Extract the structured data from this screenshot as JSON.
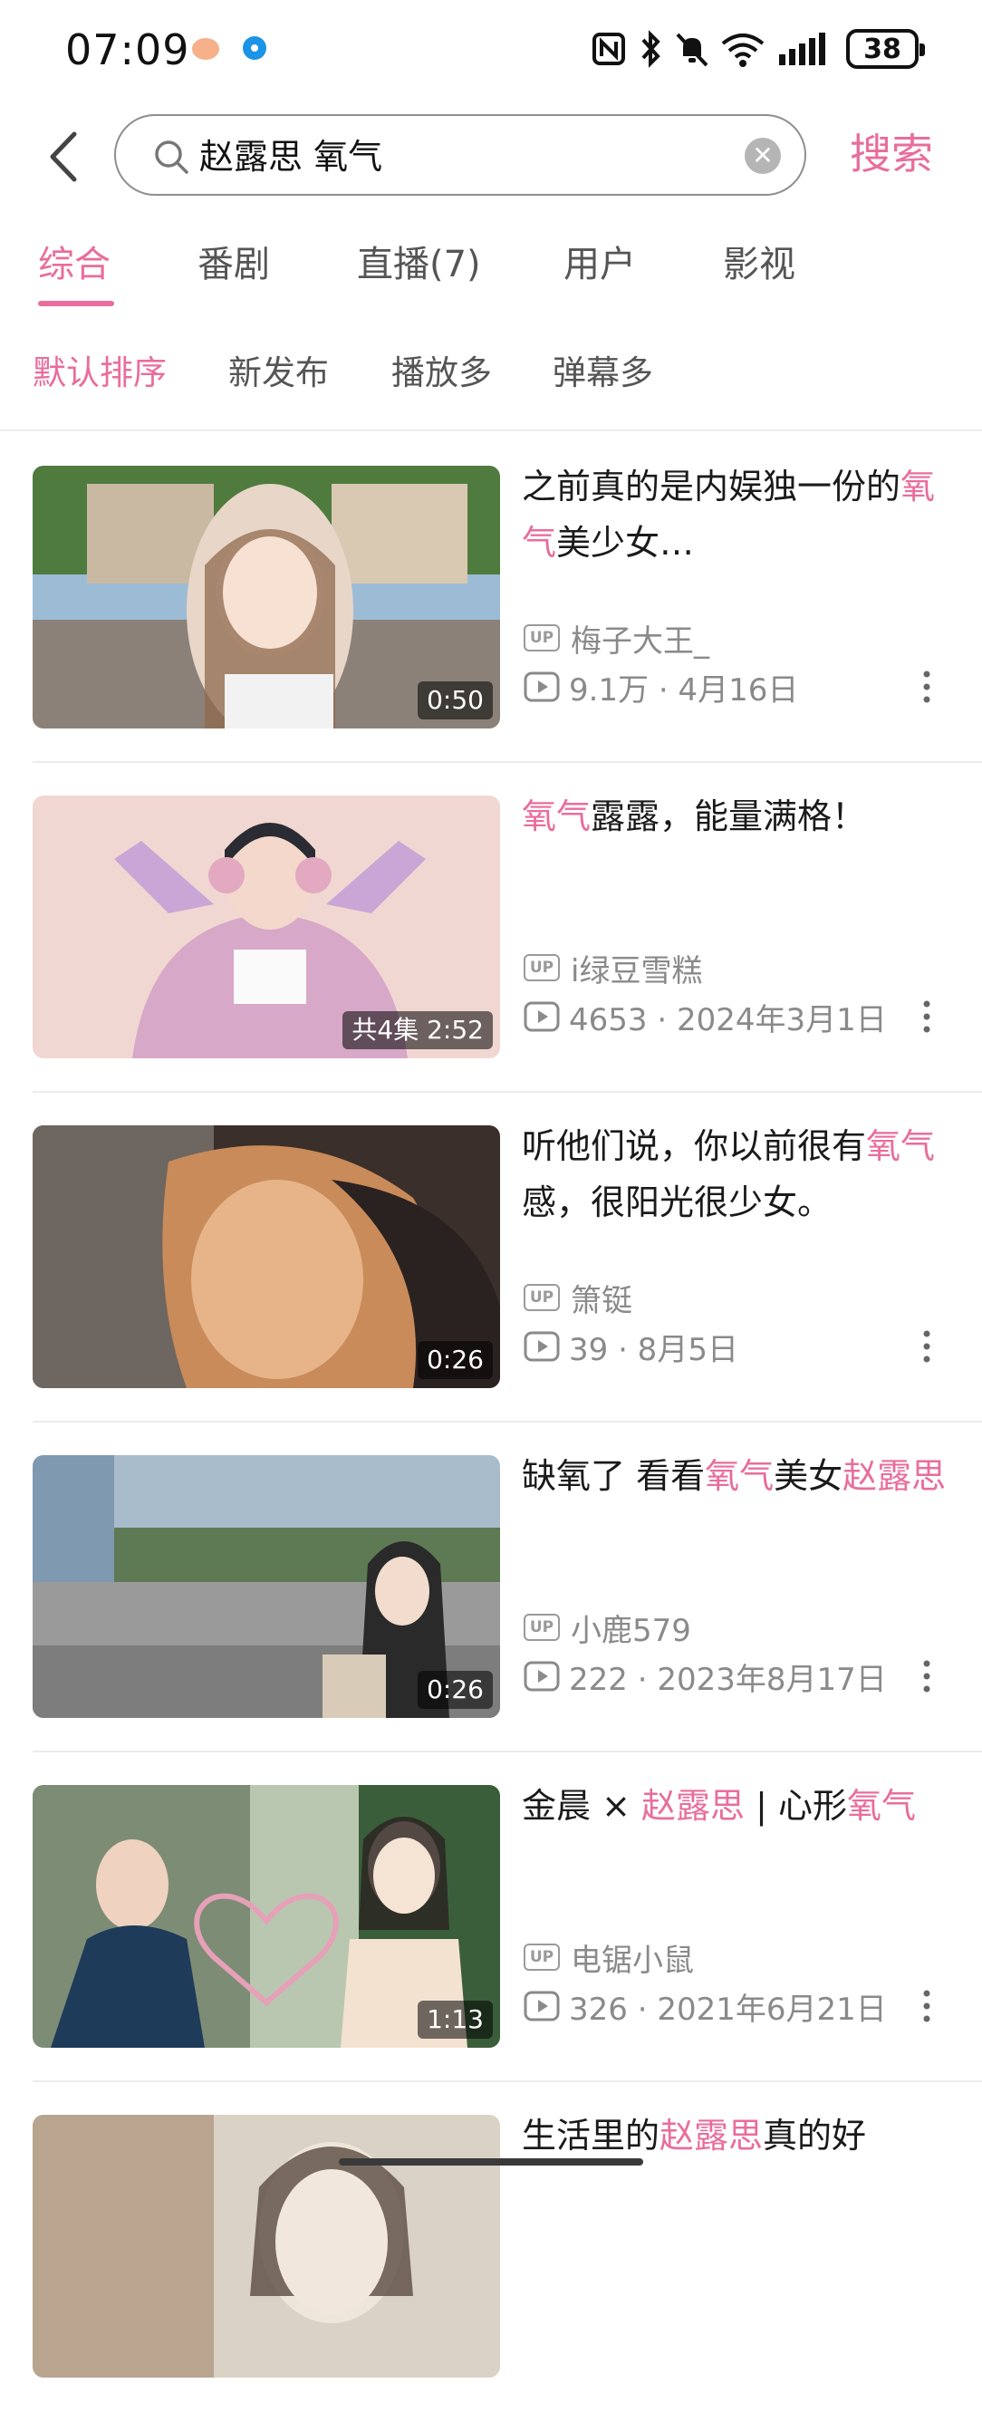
{
  "status_bar": {
    "time": "07:09",
    "battery": "38",
    "app_icons": [
      "weibo-icon",
      "app-notification-icon"
    ],
    "system_icons": [
      "nfc-icon",
      "bluetooth-icon",
      "mute-icon",
      "wifi-icon",
      "signal-icon"
    ]
  },
  "search": {
    "query": "赵露思 氧气",
    "search_button": "搜索"
  },
  "tabs": [
    {
      "label": "综合",
      "active": true
    },
    {
      "label": "番剧",
      "active": false
    },
    {
      "label": "直播(7)",
      "active": false
    },
    {
      "label": "用户",
      "active": false
    },
    {
      "label": "影视",
      "active": false
    }
  ],
  "sort_options": [
    {
      "label": "默认排序",
      "active": true
    },
    {
      "label": "新发布",
      "active": false
    },
    {
      "label": "播放多",
      "active": false
    },
    {
      "label": "弹幕多",
      "active": false
    }
  ],
  "up_badge": "UP",
  "results": [
    {
      "title": [
        {
          "t": "之前真的是内娱独一份的",
          "h": false
        },
        {
          "t": "氧气",
          "h": true
        },
        {
          "t": "美少女…",
          "h": false
        }
      ],
      "duration": "0:50",
      "uploader": "梅子大王_",
      "stats": "9.1万 · 4月16日",
      "thumb_colors": [
        "#4f7b3f",
        "#c7d8e8",
        "#e8d6c8",
        "#8f6b4e"
      ]
    },
    {
      "title": [
        {
          "t": "氧气",
          "h": true
        },
        {
          "t": "露露，能量满格！",
          "h": false
        }
      ],
      "duration": "共4集 2:52",
      "uploader": "i绿豆雪糕",
      "stats": "4653 · 2024年3月1日",
      "thumb_colors": [
        "#f1d7d2",
        "#e9b8c9",
        "#c9a6d6",
        "#2b2b33"
      ]
    },
    {
      "title": [
        {
          "t": "听他们说，你以前很有",
          "h": false
        },
        {
          "t": "氧气",
          "h": true
        },
        {
          "t": "感，很阳光很少女。",
          "h": false
        }
      ],
      "duration": "0:26",
      "uploader": "箫铤",
      "stats": "39 · 8月5日",
      "thumb_colors": [
        "#3a2f2a",
        "#c98b5a",
        "#e7b48a",
        "#6e5446"
      ]
    },
    {
      "title": [
        {
          "t": "缺氧了 看看",
          "h": false
        },
        {
          "t": "氧气",
          "h": true
        },
        {
          "t": "美女",
          "h": false
        },
        {
          "t": "赵露思",
          "h": true
        }
      ],
      "duration": "0:26",
      "uploader": "小鹿579",
      "stats": "222 · 2023年8月17日",
      "thumb_colors": [
        "#7f99b0",
        "#5d7a55",
        "#9a9a9a",
        "#3a3a3a"
      ]
    },
    {
      "title": [
        {
          "t": "金晨 × ",
          "h": false
        },
        {
          "t": "赵露思",
          "h": true
        },
        {
          "t": " | 心形",
          "h": false
        },
        {
          "t": "氧气",
          "h": true
        }
      ],
      "duration": "1:13",
      "uploader": "电锯小鼠",
      "stats": "326 · 2021年6月21日",
      "thumb_colors": [
        "#1e3b5a",
        "#e6a0b8",
        "#f3e2d0",
        "#3b5e3a"
      ]
    },
    {
      "title": [
        {
          "t": "生活里的",
          "h": false
        },
        {
          "t": "赵露思",
          "h": true
        },
        {
          "t": "真的好",
          "h": false
        }
      ],
      "duration": "",
      "uploader": "",
      "stats": "",
      "thumb_colors": [
        "#d9d2c5",
        "#b8a48f",
        "#efe6da",
        "#5a4b3f"
      ]
    }
  ]
}
